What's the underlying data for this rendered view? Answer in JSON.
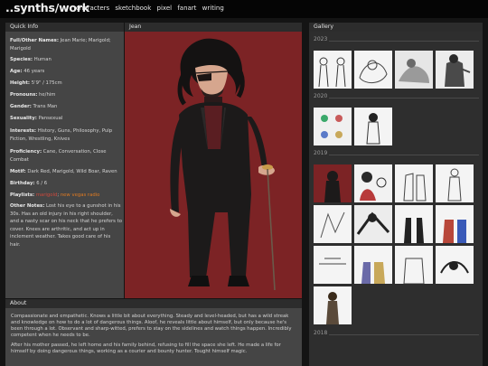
{
  "site": {
    "title": "..synths/work"
  },
  "nav": [
    "characters",
    "sketchbook",
    "pixel",
    "fanart",
    "writing"
  ],
  "quick_info": {
    "heading": "Quick Info",
    "fields": [
      {
        "label": "Full/Other Names:",
        "value": "Jean Marie; Marigold; Marigold"
      },
      {
        "label": "Species:",
        "value": "Human"
      },
      {
        "label": "Age:",
        "value": "46 years"
      },
      {
        "label": "Height:",
        "value": "5'9\" / 175cm"
      },
      {
        "label": "Pronouns:",
        "value": "he/him"
      },
      {
        "label": "Gender:",
        "value": "Trans Man"
      },
      {
        "label": "Sexuality:",
        "value": "Pansexual"
      },
      {
        "label": "Interests:",
        "value": "History, Guns, Philosophy, Pulp Fiction, Wrestling, Knives"
      },
      {
        "label": "Proficiency:",
        "value": "Cane, Conversation, Close Combat"
      },
      {
        "label": "Motif:",
        "value": "Dark Red, Marigold, Wild Boar, Raven"
      },
      {
        "label": "Birthday:",
        "value": "6 / 6"
      }
    ],
    "playlists_label": "Playlists:",
    "playlists": [
      "marigold",
      "new vegas radio"
    ],
    "other_notes_label": "Other Notes:",
    "other_notes": "Lost his eye to a gunshot in his 30s. Has an old injury in his right shoulder, and a nasty scar on his neck that he prefers to cover. Knees are arthritic, and act up in inclement weather. Takes good care of his hair."
  },
  "portrait": {
    "heading": "Jean"
  },
  "about": {
    "heading": "About",
    "paragraphs": [
      "Compassionate and empathetic. Knows a little bit about everything. Steady and level-headed, but has a wild streak and knowledge on how to do a lot of dangerous things. Aloof, he reveals little about himself, but only because he's been through a lot. Observant and sharp-witted, prefers to stay on the sidelines and watch things happen. Incredibly competent when he needs to be.",
      "After his mother passed, he left home and his family behind, refusing to fill the space she left. He made a life for himself by doing dangerous things, working as a courier and bounty hunter. Tought himself magic."
    ]
  },
  "gallery": {
    "heading": "Gallery",
    "years": [
      "2023",
      "2020",
      "2019",
      "2018"
    ]
  },
  "colors": {
    "portrait_bg": "#7c2325",
    "playlist_red": "#d0483c",
    "playlist_orange": "#e07b22"
  },
  "icons": {
    "gallery_thumbs": "artwork-thumbnail"
  }
}
